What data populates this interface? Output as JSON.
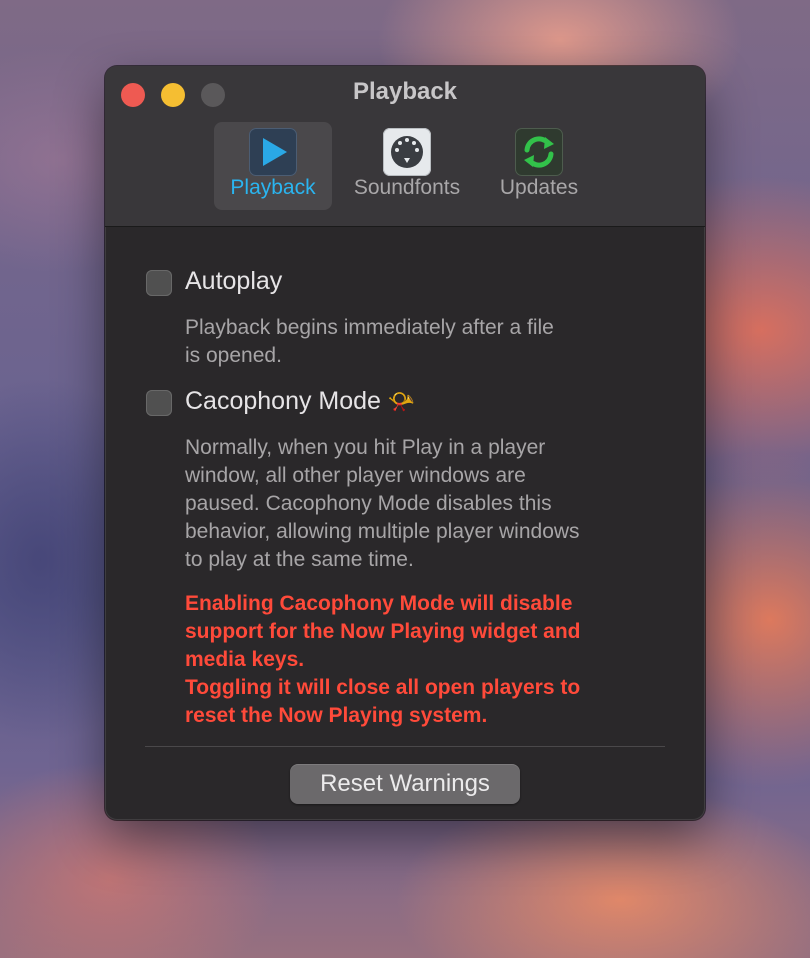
{
  "window": {
    "title": "Playback",
    "controls": [
      "close",
      "minimize",
      "zoom"
    ]
  },
  "toolbar": {
    "tabs": [
      {
        "label": "Playback",
        "icon": "play-icon",
        "selected": true
      },
      {
        "label": "Soundfonts",
        "icon": "midi-connector-icon",
        "selected": false
      },
      {
        "label": "Updates",
        "icon": "refresh-icon",
        "selected": false
      }
    ]
  },
  "options": {
    "autoplay": {
      "label": "Autoplay",
      "checked": false,
      "description_lines": [
        "Playback begins immediately after a file",
        "is opened."
      ]
    },
    "cacophony": {
      "label": "Cacophony Mode",
      "emoji": "📯",
      "checked": false,
      "description_lines": [
        "Normally, when you hit Play in a player",
        "window, all other player windows are",
        "paused. Cacophony Mode disables this",
        "behavior, allowing multiple player windows",
        "to play at the same time."
      ],
      "warning_lines": [
        "Enabling Cacophony Mode will disable",
        "support for the Now Playing widget and",
        "media keys.",
        "Toggling it will close all open players to",
        "reset the Now Playing system."
      ]
    }
  },
  "footer": {
    "reset_label": "Reset Warnings"
  },
  "colors": {
    "selected_tab_text": "#2ab5f0",
    "warning_text": "#ff4a3a",
    "close": "#ee5a52",
    "minimize": "#f5be32",
    "zoom_inactive": "#5a585a"
  }
}
